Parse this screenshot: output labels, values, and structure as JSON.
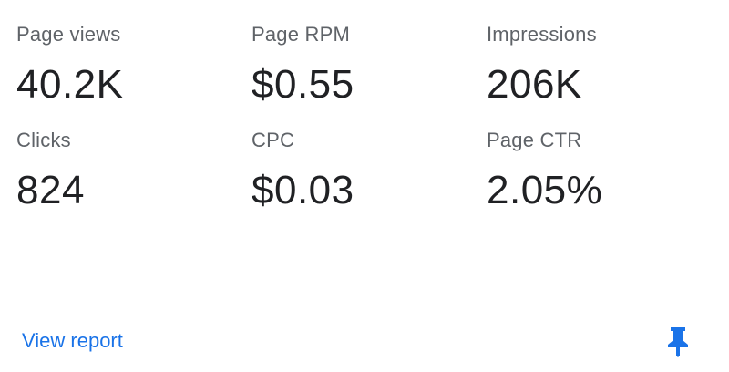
{
  "metrics": [
    {
      "label": "Page views",
      "value": "40.2K"
    },
    {
      "label": "Page RPM",
      "value": "$0.55"
    },
    {
      "label": "Impressions",
      "value": "206K"
    },
    {
      "label": "Clicks",
      "value": "824"
    },
    {
      "label": "CPC",
      "value": "$0.03"
    },
    {
      "label": "Page CTR",
      "value": "2.05%"
    }
  ],
  "footer": {
    "link_label": "View report",
    "pin_icon": "pin-icon"
  },
  "colors": {
    "link": "#1a73e8",
    "label": "#5f6368",
    "value": "#202124",
    "pin": "#1a73e8"
  }
}
